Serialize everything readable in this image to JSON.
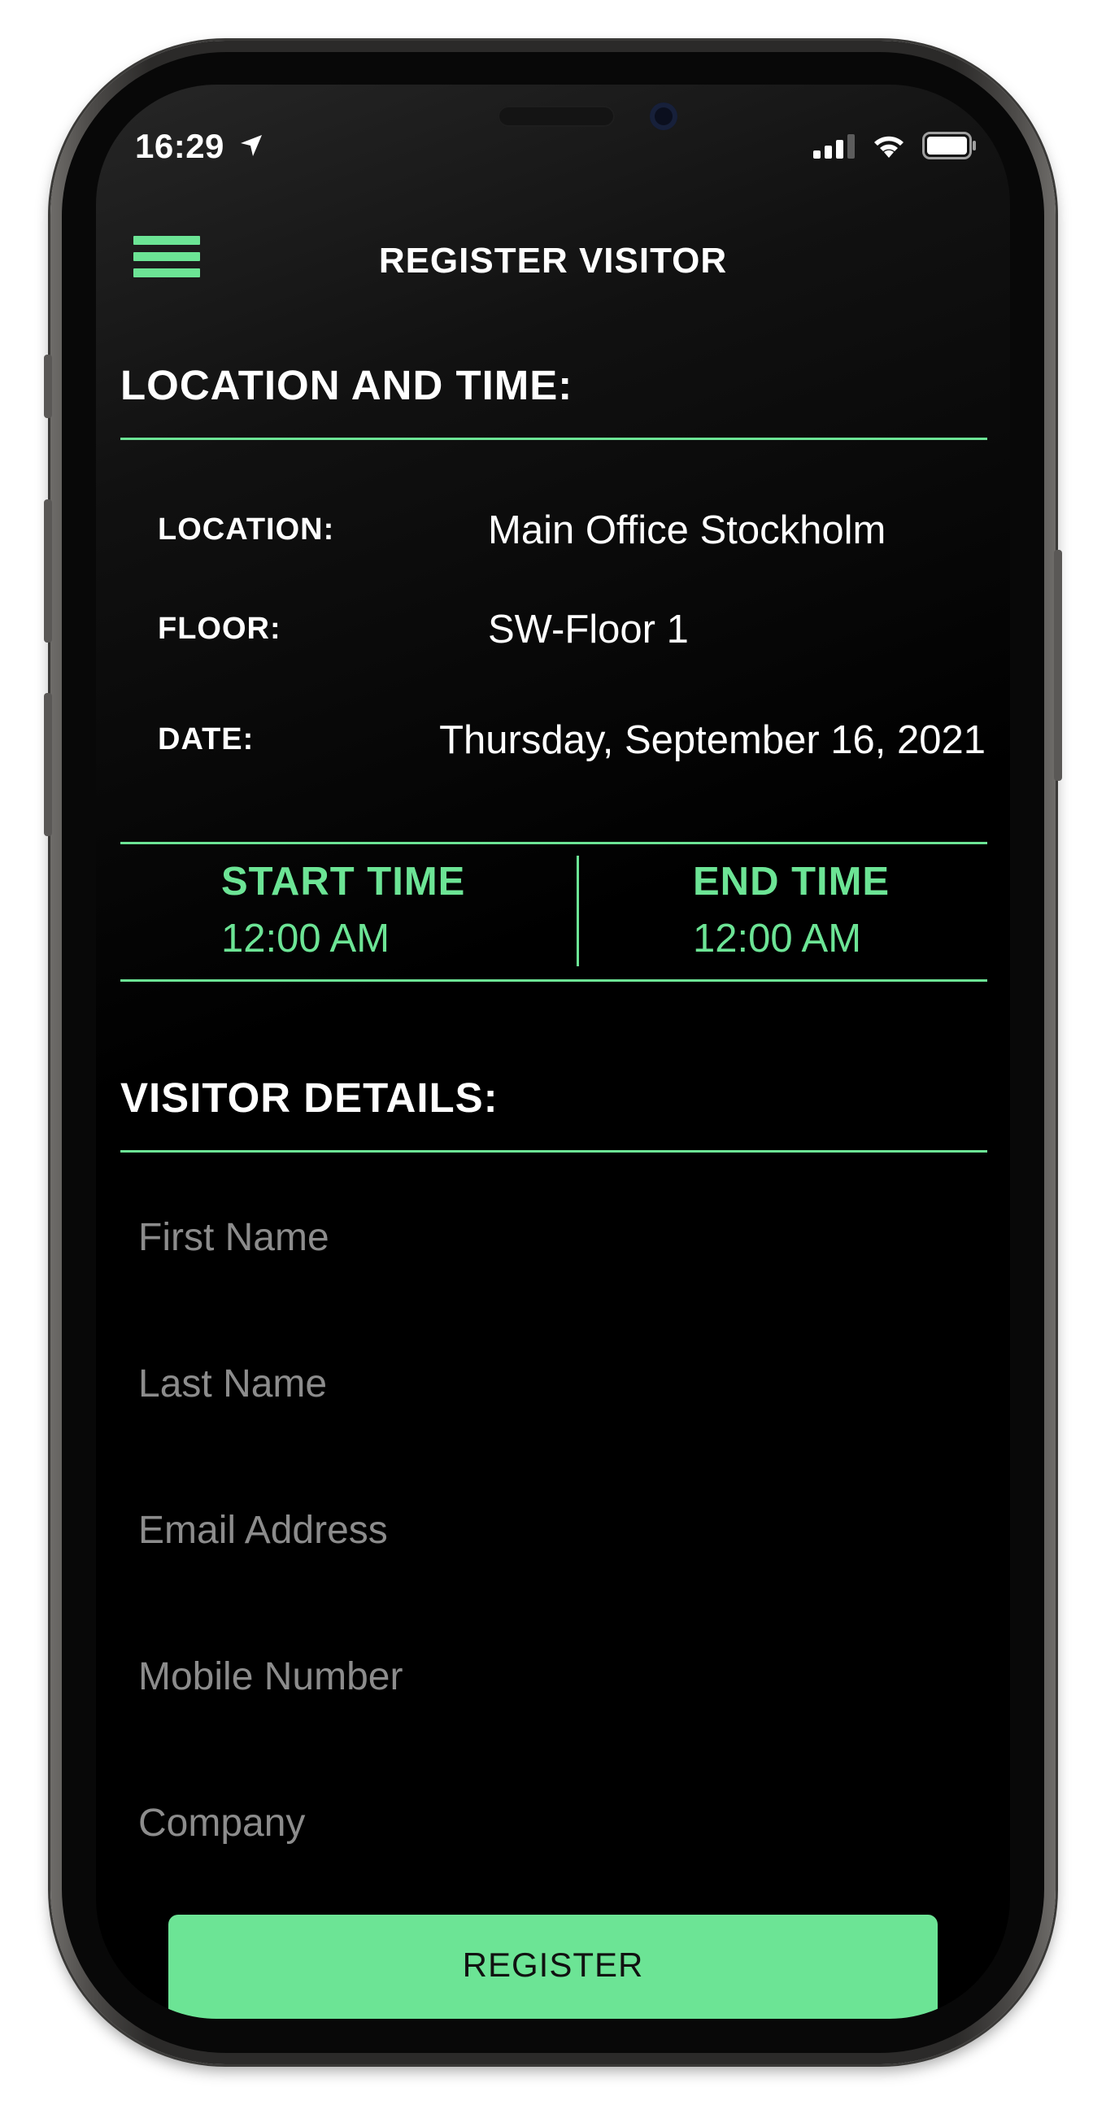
{
  "status_bar": {
    "time": "16:29"
  },
  "nav": {
    "title": "REGISTER VISITOR"
  },
  "location_time": {
    "heading": "LOCATION AND TIME:",
    "location_label": "LOCATION:",
    "location_value": "Main Office Stockholm",
    "floor_label": "FLOOR:",
    "floor_value": "SW-Floor 1",
    "date_label": "DATE:",
    "date_value": "Thursday, September 16, 2021"
  },
  "times": {
    "start_label": "START TIME",
    "start_value": "12:00 AM",
    "end_label": "END TIME",
    "end_value": "12:00 AM"
  },
  "visitor": {
    "heading": "VISITOR DETAILS:",
    "first_name_placeholder": "First Name",
    "last_name_placeholder": "Last Name",
    "email_placeholder": "Email Address",
    "mobile_placeholder": "Mobile Number",
    "company_placeholder": "Company"
  },
  "register_label": "REGISTER",
  "colors": {
    "accent": "#6ce495",
    "background": "#000000",
    "placeholder": "#8c8c8c"
  }
}
